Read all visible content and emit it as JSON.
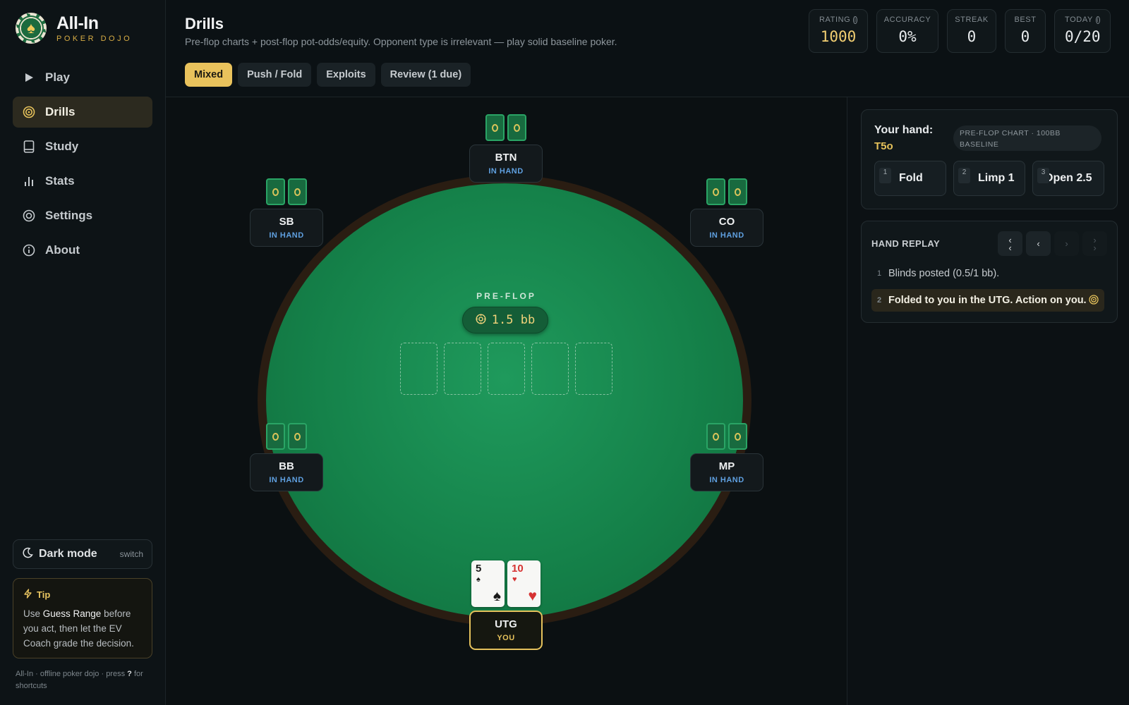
{
  "app": {
    "name": "All-In",
    "tagline": "POKER DOJO"
  },
  "nav": [
    {
      "label": "Play",
      "icon": "play-icon"
    },
    {
      "label": "Drills",
      "icon": "target-icon",
      "active": true
    },
    {
      "label": "Study",
      "icon": "book-icon"
    },
    {
      "label": "Stats",
      "icon": "bar-chart-icon"
    },
    {
      "label": "Settings",
      "icon": "settings-icon"
    },
    {
      "label": "About",
      "icon": "info-icon"
    }
  ],
  "dark_mode": {
    "label": "Dark mode",
    "action": "switch"
  },
  "tip": {
    "title": "Tip",
    "pre": "Use ",
    "highlight": "Guess Range",
    "post": " before you act, then let the EV Coach grade the decision."
  },
  "footer": {
    "text": "All-In · offline poker dojo · press ",
    "key": "?",
    "suffix": " for shortcuts"
  },
  "page": {
    "title": "Drills",
    "subtitle": "Pre-flop charts + post-flop pot-odds/equity. Opponent type is irrelevant — play solid baseline poker."
  },
  "tabs": [
    {
      "label": "Mixed",
      "active": true
    },
    {
      "label": "Push / Fold"
    },
    {
      "label": "Exploits"
    },
    {
      "label": "Review (1 due)"
    }
  ],
  "stats": [
    {
      "label": "RATING",
      "value": "1000",
      "info": true,
      "accent": true
    },
    {
      "label": "ACCURACY",
      "value": "0%"
    },
    {
      "label": "STREAK",
      "value": "0"
    },
    {
      "label": "BEST",
      "value": "0"
    },
    {
      "label": "TODAY",
      "value": "0/20",
      "info": true
    }
  ],
  "table": {
    "street": "PRE-FLOP",
    "pot": "1.5 bb",
    "board_slots": 5,
    "seats": [
      {
        "name": "BTN",
        "status": "IN HAND"
      },
      {
        "name": "SB",
        "status": "IN HAND"
      },
      {
        "name": "CO",
        "status": "IN HAND"
      },
      {
        "name": "BB",
        "status": "IN HAND"
      },
      {
        "name": "MP",
        "status": "IN HAND"
      },
      {
        "name": "UTG",
        "status": "YOU",
        "hero": true
      }
    ],
    "hero_cards": [
      {
        "rank": "5",
        "suit": "♠",
        "color": "black"
      },
      {
        "rank": "10",
        "suit": "♥",
        "color": "red"
      }
    ]
  },
  "hand_panel": {
    "label": "Your hand:",
    "hand": "T5o",
    "badge": "PRE-FLOP CHART · 100BB BASELINE",
    "actions": [
      {
        "key": "1",
        "label": "Fold"
      },
      {
        "key": "2",
        "label": "Limp 1"
      },
      {
        "key": "3",
        "label": "Open 2.5"
      }
    ]
  },
  "replay": {
    "title": "HAND REPLAY",
    "steps": [
      {
        "n": "1",
        "text": "Blinds posted (0.5/1 bb)."
      },
      {
        "n": "2",
        "text": "Folded to you in the UTG. Action on you.",
        "current": true
      }
    ]
  },
  "colors": {
    "accent": "#e9c25c",
    "felt": "#15824a",
    "status_blue": "#5fa0e0"
  }
}
